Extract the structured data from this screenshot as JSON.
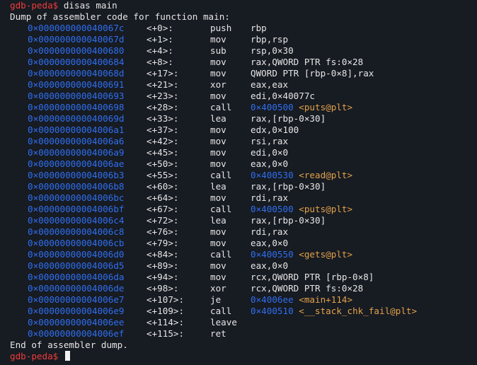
{
  "terminal": {
    "prompt": "gdb-peda$",
    "command": "disas main",
    "header": "Dump of assembler code for function main:",
    "footer": "End of assembler dump.",
    "final_prompt": "gdb-peda$",
    "colors": {
      "background": "#171b22",
      "prompt": "#ef3b3b",
      "address": "#2f6ff0",
      "symbol": "#e2a24a",
      "text": "#e6e6e6"
    },
    "rows": [
      {
        "addr": "0×000000000040067c",
        "off": "<+0>:",
        "mn": "push",
        "ops": "rbp",
        "target": "",
        "sym": ""
      },
      {
        "addr": "0×000000000040067d",
        "off": "<+1>:",
        "mn": "mov",
        "ops": "rbp,rsp",
        "target": "",
        "sym": ""
      },
      {
        "addr": "0×0000000000400680",
        "off": "<+4>:",
        "mn": "sub",
        "ops": "rsp,0×30",
        "target": "",
        "sym": ""
      },
      {
        "addr": "0×0000000000400684",
        "off": "<+8>:",
        "mn": "mov",
        "ops": "rax,QWORD PTR fs:0×28",
        "target": "",
        "sym": ""
      },
      {
        "addr": "0×000000000040068d",
        "off": "<+17>:",
        "mn": "mov",
        "ops": "QWORD PTR [rbp-0×8],rax",
        "target": "",
        "sym": ""
      },
      {
        "addr": "0×0000000000400691",
        "off": "<+21>:",
        "mn": "xor",
        "ops": "eax,eax",
        "target": "",
        "sym": ""
      },
      {
        "addr": "0×0000000000400693",
        "off": "<+23>:",
        "mn": "mov",
        "ops": "edi,0×40077c",
        "target": "",
        "sym": ""
      },
      {
        "addr": "0×0000000000400698",
        "off": "<+28>:",
        "mn": "call",
        "ops": "",
        "target": "0×400500",
        "sym": "<puts@plt>"
      },
      {
        "addr": "0×000000000040069d",
        "off": "<+33>:",
        "mn": "lea",
        "ops": "rax,[rbp-0×30]",
        "target": "",
        "sym": ""
      },
      {
        "addr": "0×00000000004006a1",
        "off": "<+37>:",
        "mn": "mov",
        "ops": "edx,0×100",
        "target": "",
        "sym": ""
      },
      {
        "addr": "0×00000000004006a6",
        "off": "<+42>:",
        "mn": "mov",
        "ops": "rsi,rax",
        "target": "",
        "sym": ""
      },
      {
        "addr": "0×00000000004006a9",
        "off": "<+45>:",
        "mn": "mov",
        "ops": "edi,0×0",
        "target": "",
        "sym": ""
      },
      {
        "addr": "0×00000000004006ae",
        "off": "<+50>:",
        "mn": "mov",
        "ops": "eax,0×0",
        "target": "",
        "sym": ""
      },
      {
        "addr": "0×00000000004006b3",
        "off": "<+55>:",
        "mn": "call",
        "ops": "",
        "target": "0×400530",
        "sym": "<read@plt>"
      },
      {
        "addr": "0×00000000004006b8",
        "off": "<+60>:",
        "mn": "lea",
        "ops": "rax,[rbp-0×30]",
        "target": "",
        "sym": ""
      },
      {
        "addr": "0×00000000004006bc",
        "off": "<+64>:",
        "mn": "mov",
        "ops": "rdi,rax",
        "target": "",
        "sym": ""
      },
      {
        "addr": "0×00000000004006bf",
        "off": "<+67>:",
        "mn": "call",
        "ops": "",
        "target": "0×400500",
        "sym": "<puts@plt>"
      },
      {
        "addr": "0×00000000004006c4",
        "off": "<+72>:",
        "mn": "lea",
        "ops": "rax,[rbp-0×30]",
        "target": "",
        "sym": ""
      },
      {
        "addr": "0×00000000004006c8",
        "off": "<+76>:",
        "mn": "mov",
        "ops": "rdi,rax",
        "target": "",
        "sym": ""
      },
      {
        "addr": "0×00000000004006cb",
        "off": "<+79>:",
        "mn": "mov",
        "ops": "eax,0×0",
        "target": "",
        "sym": ""
      },
      {
        "addr": "0×00000000004006d0",
        "off": "<+84>:",
        "mn": "call",
        "ops": "",
        "target": "0×400550",
        "sym": "<gets@plt>"
      },
      {
        "addr": "0×00000000004006d5",
        "off": "<+89>:",
        "mn": "mov",
        "ops": "eax,0×0",
        "target": "",
        "sym": ""
      },
      {
        "addr": "0×00000000004006da",
        "off": "<+94>:",
        "mn": "mov",
        "ops": "rcx,QWORD PTR [rbp-0×8]",
        "target": "",
        "sym": ""
      },
      {
        "addr": "0×00000000004006de",
        "off": "<+98>:",
        "mn": "xor",
        "ops": "rcx,QWORD PTR fs:0×28",
        "target": "",
        "sym": ""
      },
      {
        "addr": "0×00000000004006e7",
        "off": "<+107>:",
        "mn": "je",
        "ops": "",
        "target": "0×4006ee",
        "sym": "<main+114>"
      },
      {
        "addr": "0×00000000004006e9",
        "off": "<+109>:",
        "mn": "call",
        "ops": "",
        "target": "0×400510",
        "sym": "<__stack_chk_fail@plt>"
      },
      {
        "addr": "0×00000000004006ee",
        "off": "<+114>:",
        "mn": "leave",
        "ops": "",
        "target": "",
        "sym": ""
      },
      {
        "addr": "0×00000000004006ef",
        "off": "<+115>:",
        "mn": "ret",
        "ops": "",
        "target": "",
        "sym": ""
      }
    ]
  }
}
